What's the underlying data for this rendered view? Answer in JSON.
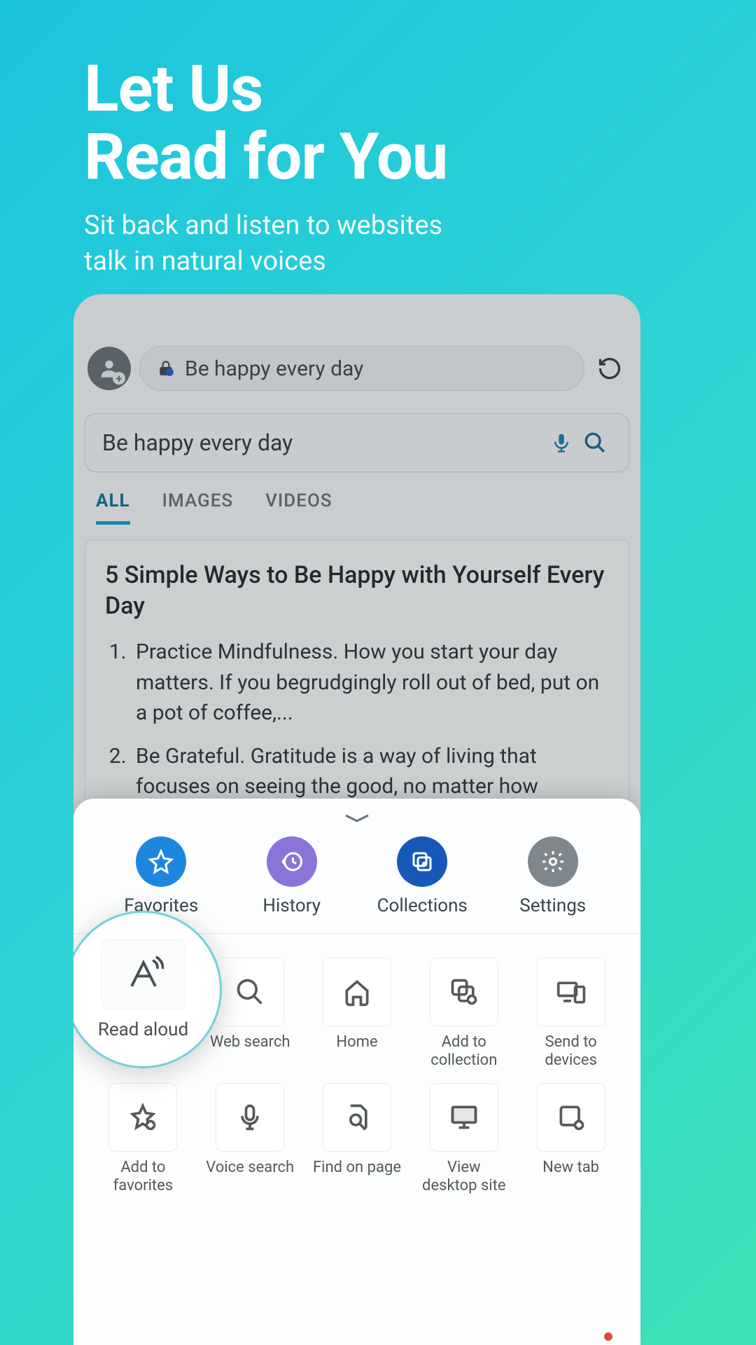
{
  "promo": {
    "title_line1": "Let Us",
    "title_line2": "Read for You",
    "subtitle_line1": "Sit back and listen to websites",
    "subtitle_line2": "talk in natural voices"
  },
  "browser": {
    "address_text": "Be happy every day",
    "search_text": "Be happy every day",
    "tabs": {
      "all": "ALL",
      "images": "IMAGES",
      "videos": "VIDEOS"
    },
    "result": {
      "title": "5 Simple Ways to Be Happy with Yourself Every Day",
      "item1": "Practice Mindfulness. How you start your day matters. If you begrudgingly roll out of bed, put on a pot of coffee,...",
      "item2": "Be Grateful. Gratitude is a way of living that focuses on seeing the good, no matter how"
    }
  },
  "sheet": {
    "row1": {
      "favorites": "Favorites",
      "history": "History",
      "collections": "Collections",
      "settings": "Settings"
    },
    "highlight": {
      "label": "Read aloud"
    },
    "grid": {
      "web_search": "Web search",
      "home": "Home",
      "add_to_collection": "Add to collection",
      "send_to_devices": "Send to devices",
      "add_to_favorites": "Add to favorites",
      "voice_search": "Voice search",
      "find_on_page": "Find on page",
      "view_desktop_site": "View desktop site",
      "new_tab": "New tab"
    }
  }
}
